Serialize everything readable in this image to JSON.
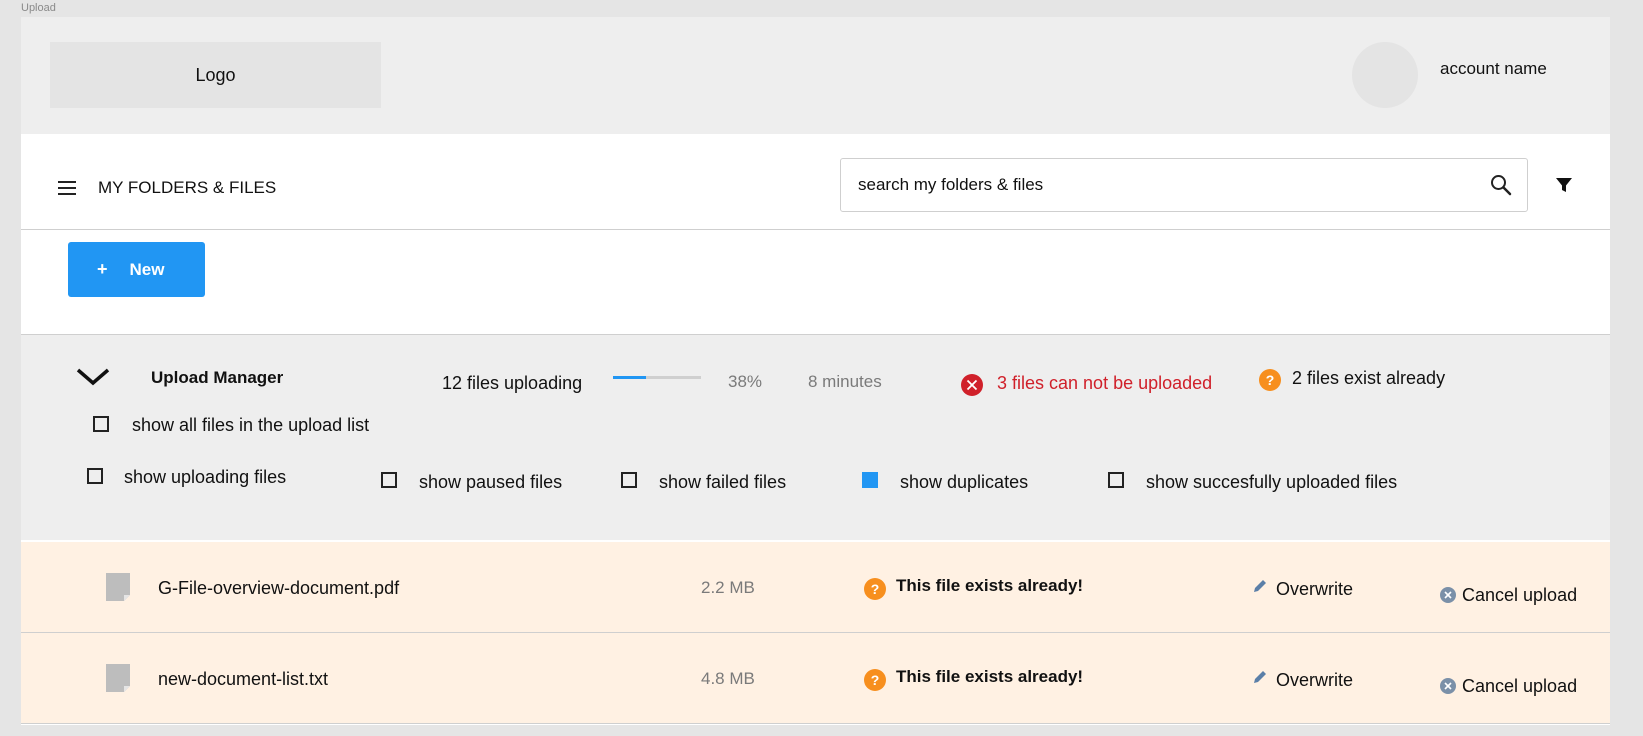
{
  "frame_label": "Upload",
  "header": {
    "logo": "Logo",
    "account_name": "account name"
  },
  "toolbar": {
    "title": "MY FOLDERS & FILES",
    "search_placeholder": "search my folders & files"
  },
  "new_button": {
    "plus": "+",
    "label": "New"
  },
  "upload_manager": {
    "title": "Upload Manager",
    "files_uploading": "12 files uploading",
    "progress": 0.38,
    "percent": "38%",
    "time_remaining": "8 minutes",
    "error_text": "3 files can not be uploaded",
    "exist_text": "2 files exist already",
    "filters": [
      {
        "label": "show all files in the upload list",
        "checked": false
      },
      {
        "label": "show uploading files",
        "checked": false
      },
      {
        "label": "show paused files",
        "checked": false
      },
      {
        "label": "show failed files",
        "checked": false
      },
      {
        "label": "show duplicates",
        "checked": true
      },
      {
        "label": "show succesfully uploaded files",
        "checked": false
      }
    ]
  },
  "files": [
    {
      "name": "G-File-overview-document.pdf",
      "size": "2.2 MB",
      "status": "This file exists already!",
      "overwrite": "Overwrite",
      "cancel": "Cancel upload"
    },
    {
      "name": "new-document-list.txt",
      "size": "4.8 MB",
      "status": "This file exists already!",
      "overwrite": "Overwrite",
      "cancel": "Cancel upload"
    }
  ],
  "colors": {
    "accent": "#2196f3",
    "warning": "#f78f1e",
    "error": "#d0202a",
    "duplicate_row": "#fff1e3"
  }
}
